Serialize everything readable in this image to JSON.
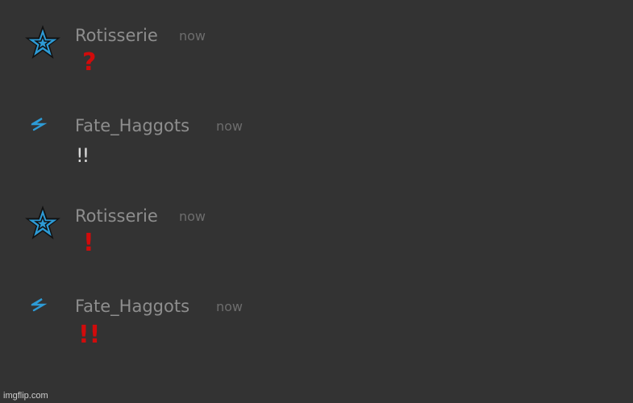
{
  "messages": [
    {
      "author": "Rotisserie",
      "timestamp": "now",
      "avatar_icon": "star-icon",
      "content": "?",
      "content_style": "red-emoji"
    },
    {
      "author": "Fate_Haggots",
      "timestamp": "now",
      "avatar_icon": "zigzag-icon",
      "content": "!!",
      "content_style": "plain"
    },
    {
      "author": "Rotisserie",
      "timestamp": "now",
      "avatar_icon": "star-icon",
      "content": "!",
      "content_style": "red-emoji"
    },
    {
      "author": "Fate_Haggots",
      "timestamp": "now",
      "avatar_icon": "zigzag-icon",
      "content": "!!",
      "content_style": "red-emoji"
    }
  ],
  "watermark": "imgflip.com",
  "colors": {
    "background": "#333333",
    "username": "#8e8e8e",
    "timestamp": "#6d6d6d",
    "red_emoji": "#d10b0b",
    "plain_text": "#d8d8d8",
    "avatar_accent": "#2d9bd6"
  }
}
